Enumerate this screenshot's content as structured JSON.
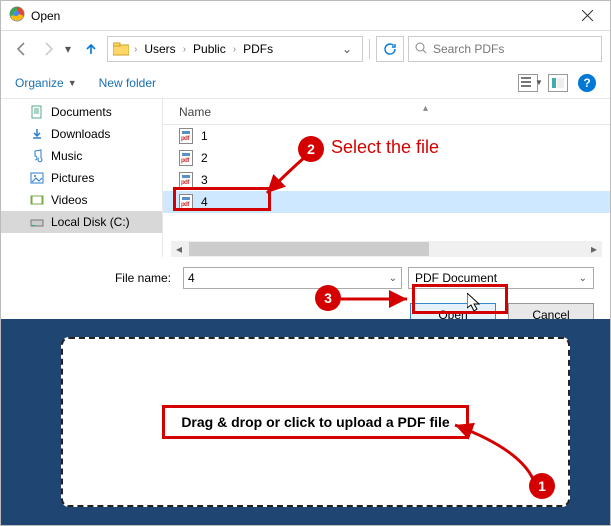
{
  "title": "Open",
  "breadcrumb": {
    "seg1": "Users",
    "seg2": "Public",
    "seg3": "PDFs"
  },
  "search": {
    "placeholder": "Search PDFs"
  },
  "toolbar": {
    "organize": "Organize",
    "newfolder": "New folder"
  },
  "columns": {
    "name": "Name"
  },
  "sidebar": {
    "items": [
      {
        "label": "Documents"
      },
      {
        "label": "Downloads"
      },
      {
        "label": "Music"
      },
      {
        "label": "Pictures"
      },
      {
        "label": "Videos"
      },
      {
        "label": "Local Disk (C:)"
      }
    ]
  },
  "files": [
    {
      "name": "1"
    },
    {
      "name": "2"
    },
    {
      "name": "3"
    },
    {
      "name": "4"
    }
  ],
  "filename": {
    "label": "File name:",
    "value": "4"
  },
  "filetype": {
    "label": "PDF Document"
  },
  "buttons": {
    "open": "Open",
    "cancel": "Cancel"
  },
  "dropzone": {
    "text": "Drag & drop or click to upload a PDF file"
  },
  "annotations": {
    "step1": "1",
    "step2": "2",
    "step3": "3",
    "step2_text": "Select the file"
  }
}
